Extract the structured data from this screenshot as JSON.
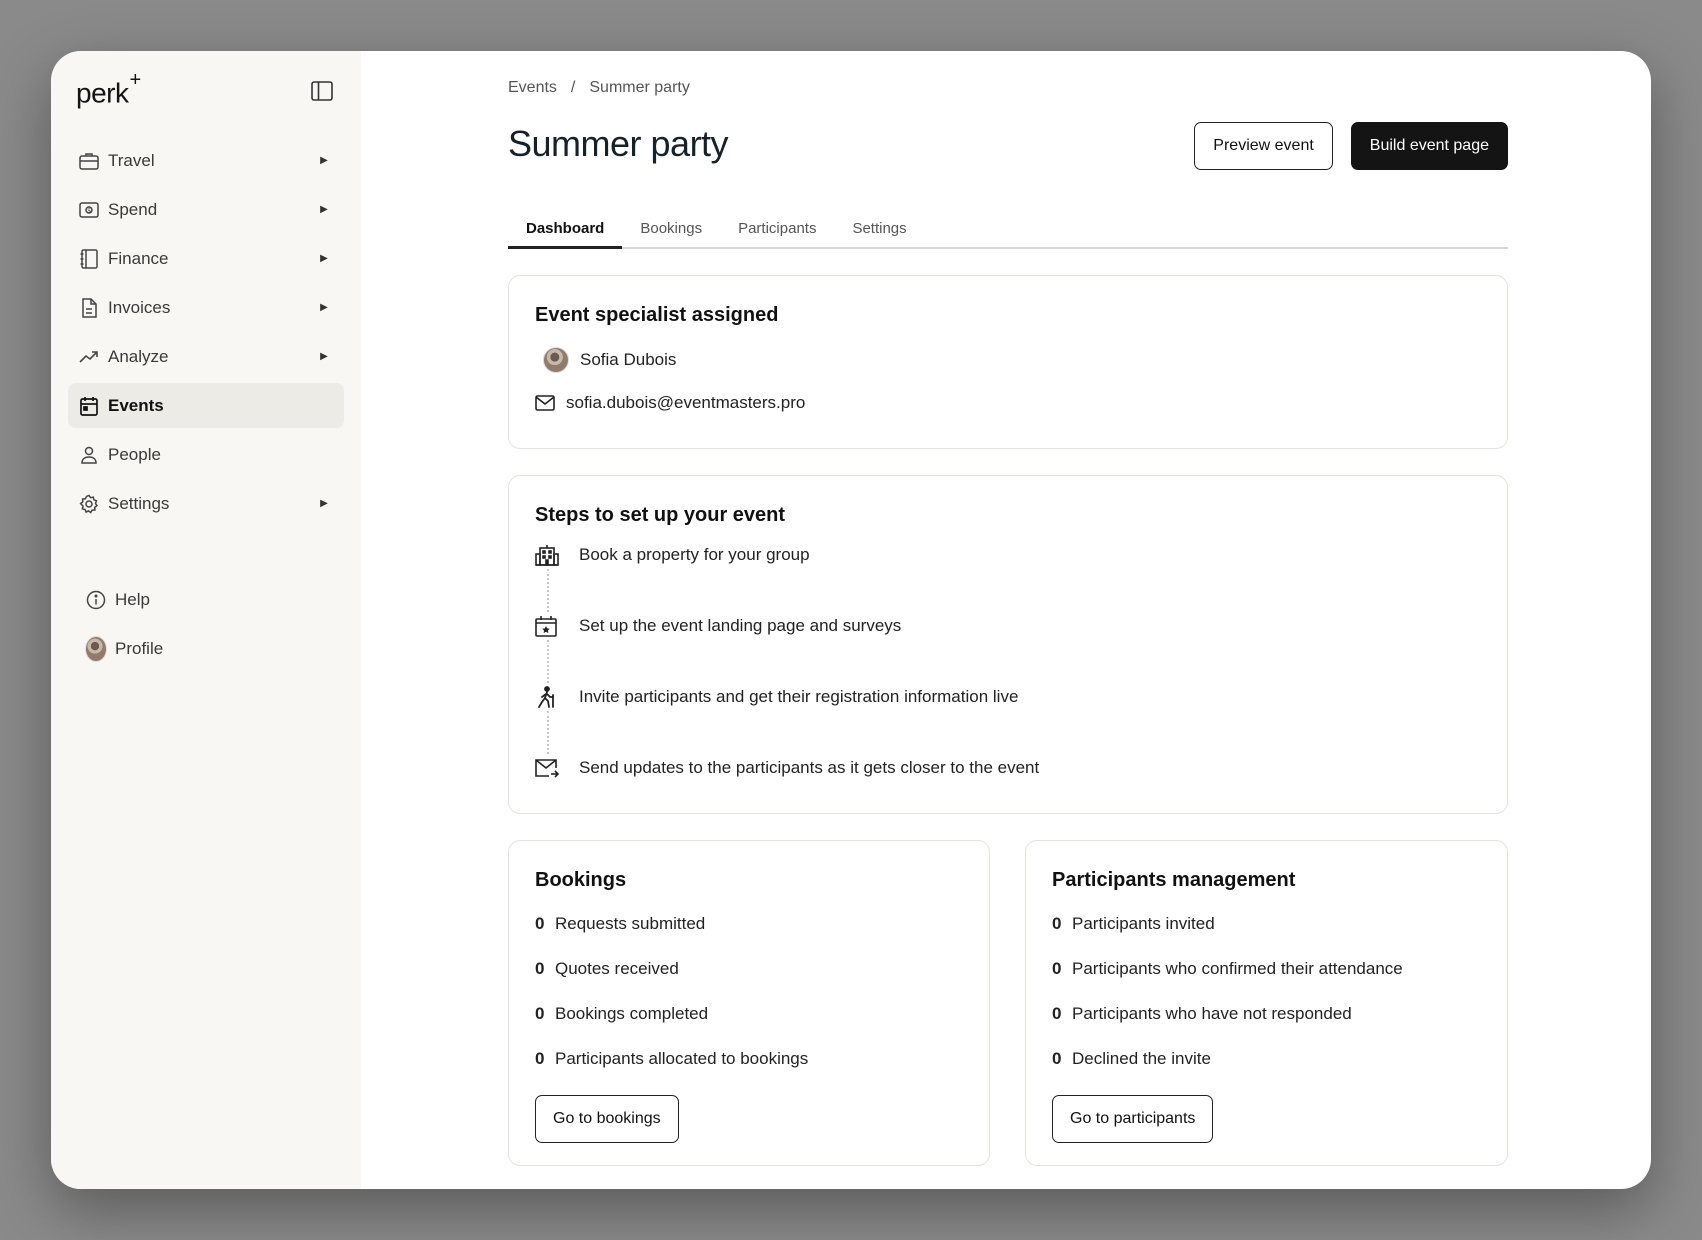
{
  "app": {
    "logo_text": "perk",
    "logo_mark": "+"
  },
  "sidebar": {
    "items": [
      {
        "label": "Travel",
        "icon": "briefcase-icon",
        "has_submenu": true
      },
      {
        "label": "Spend",
        "icon": "cash-icon",
        "has_submenu": true
      },
      {
        "label": "Finance",
        "icon": "ledger-icon",
        "has_submenu": true
      },
      {
        "label": "Invoices",
        "icon": "document-icon",
        "has_submenu": true
      },
      {
        "label": "Analyze",
        "icon": "trend-icon",
        "has_submenu": true
      },
      {
        "label": "Events",
        "icon": "calendar-icon",
        "has_submenu": false,
        "active": true
      },
      {
        "label": "People",
        "icon": "person-icon",
        "has_submenu": false
      },
      {
        "label": "Settings",
        "icon": "gear-icon",
        "has_submenu": true
      }
    ],
    "bottom": [
      {
        "label": "Help",
        "icon": "info-icon"
      },
      {
        "label": "Profile",
        "icon": "avatar"
      }
    ]
  },
  "breadcrumb": {
    "parent": "Events",
    "separator": "/",
    "current": "Summer party"
  },
  "header": {
    "title": "Summer party",
    "preview_label": "Preview event",
    "build_label": "Build event page"
  },
  "tabs": [
    {
      "label": "Dashboard",
      "active": true
    },
    {
      "label": "Bookings"
    },
    {
      "label": "Participants"
    },
    {
      "label": "Settings"
    }
  ],
  "specialist": {
    "title": "Event specialist assigned",
    "name": "Sofia Dubois",
    "email": "sofia.dubois@eventmasters.pro"
  },
  "steps": {
    "title": "Steps to set up your event",
    "items": [
      {
        "label": "Book a property for your group",
        "icon": "building-icon"
      },
      {
        "label": "Set up the event landing page and surveys",
        "icon": "calendar-star-icon"
      },
      {
        "label": "Invite participants and get their registration information live",
        "icon": "walking-person-icon"
      },
      {
        "label": "Send updates to the participants as it gets closer to the event",
        "icon": "mail-send-icon"
      }
    ]
  },
  "bookings": {
    "title": "Bookings",
    "stats": [
      {
        "value": "0",
        "label": "Requests submitted"
      },
      {
        "value": "0",
        "label": "Quotes received"
      },
      {
        "value": "0",
        "label": "Bookings completed"
      },
      {
        "value": "0",
        "label": "Participants allocated to bookings"
      }
    ],
    "button_label": "Go to bookings"
  },
  "participants": {
    "title": "Participants management",
    "stats": [
      {
        "value": "0",
        "label": "Participants invited"
      },
      {
        "value": "0",
        "label": "Participants who confirmed their attendance"
      },
      {
        "value": "0",
        "label": "Participants who have not responded"
      },
      {
        "value": "0",
        "label": "Declined the invite"
      }
    ],
    "button_label": "Go to participants"
  },
  "colors": {
    "primary_button": "#141414",
    "sidebar_bg": "#f8f7f3",
    "active_nav": "#ecebe6"
  }
}
